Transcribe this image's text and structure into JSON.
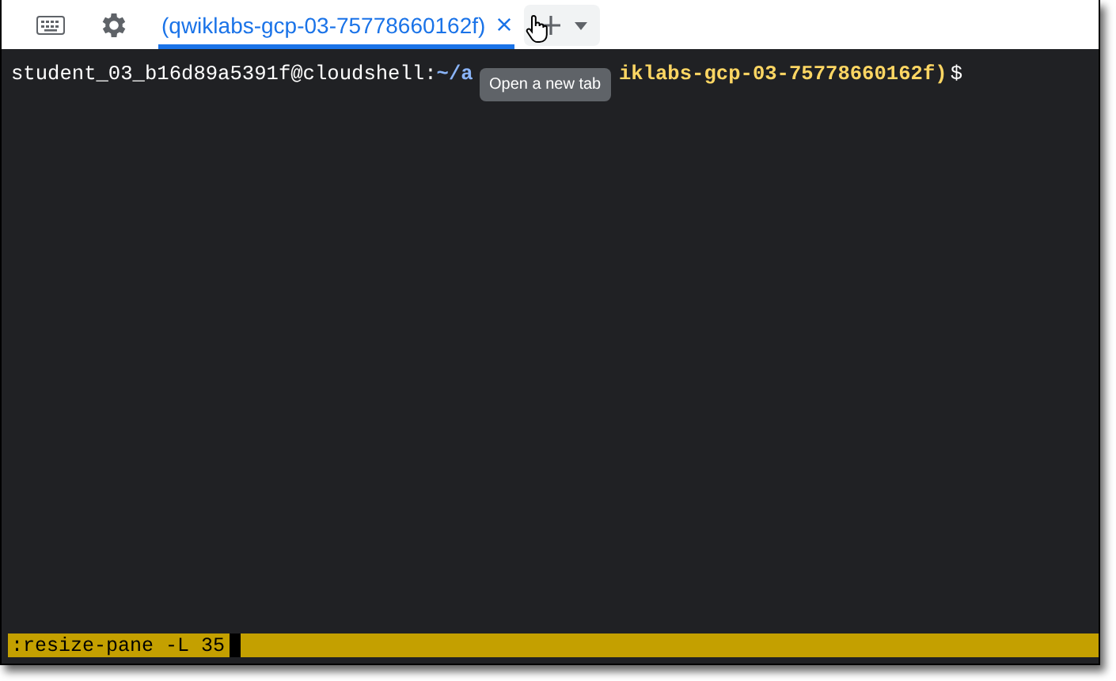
{
  "tabs": [
    {
      "label": "(qwiklabs-gcp-03-75778660162f)",
      "selected": true
    }
  ],
  "tooltip": "Open a new tab",
  "terminal": {
    "prompt_user": "student_03_b16d89a5391f@cloudshell:",
    "prompt_path": "~/a",
    "prompt_project": "iklabs-gcp-03-75778660162f)",
    "prompt_symbol": "$"
  },
  "status_bar": {
    "command": ":resize-pane -L 35"
  }
}
